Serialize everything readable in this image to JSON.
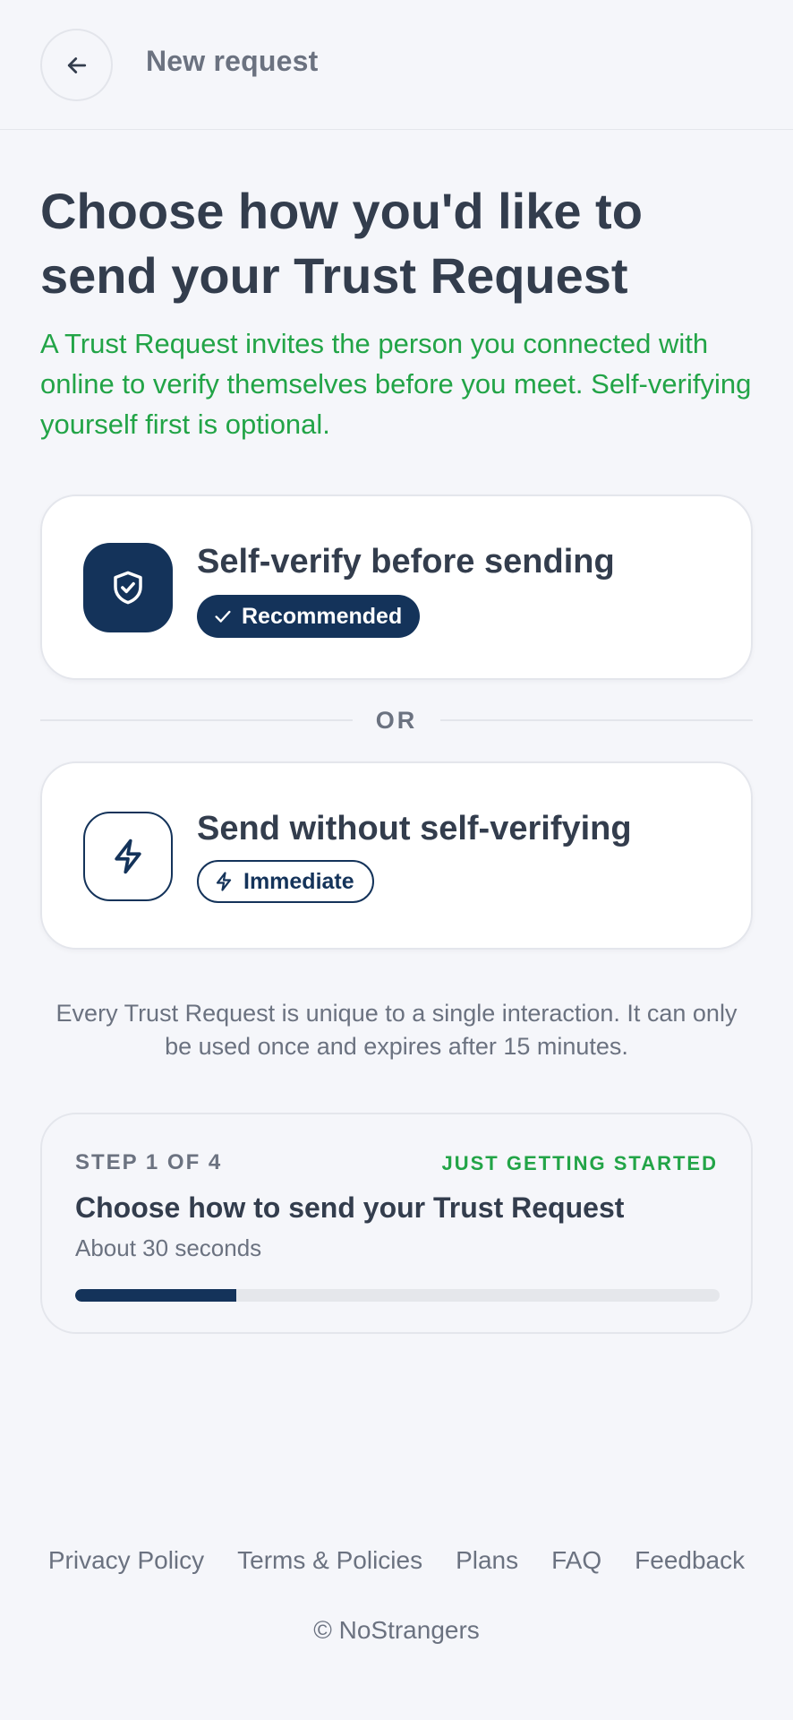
{
  "header": {
    "back_icon": "arrow-left-icon",
    "title": "New request"
  },
  "main": {
    "title": "Choose how you'd like to send your Trust Request",
    "subtitle": "A Trust Request invites the person you connected with online to verify themselves before you meet. Self-verifying yourself first is optional.",
    "subtitle_color": "#22a447"
  },
  "options": [
    {
      "icon": "shield-check-icon",
      "title": "Self-verify before sending",
      "badge_icon": "check-icon",
      "badge": "Recommended"
    },
    {
      "icon": "lightning-icon",
      "title": "Send without self-verifying",
      "badge_icon": "lightning-icon",
      "badge": "Immediate"
    }
  ],
  "divider": {
    "label": "OR"
  },
  "note": "Every Trust Request is unique to a single interaction. It can only be used once and expires after 15 minutes.",
  "progress": {
    "step_label": "STEP 1 OF 4",
    "status": "JUST GETTING STARTED",
    "title": "Choose how to send your Trust Request",
    "time": "About 30 seconds",
    "fraction": 0.25,
    "accent_color": "#14335a"
  },
  "footer": {
    "links": [
      "Privacy Policy",
      "Terms & Policies",
      "Plans",
      "FAQ",
      "Feedback"
    ],
    "copyright": "© NoStrangers"
  }
}
